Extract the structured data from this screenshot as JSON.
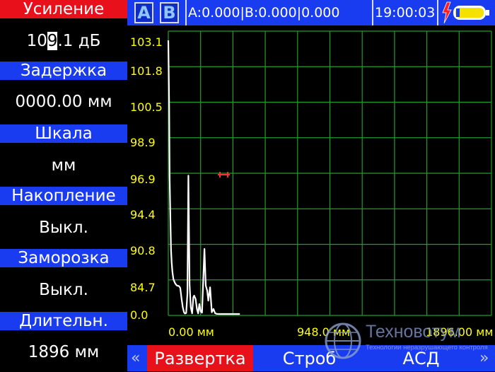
{
  "sidebar": {
    "gain_label": "Усиление",
    "gain_value_prefix": "10",
    "gain_value_cursor": "9",
    "gain_value_suffix": ".1 дБ",
    "delay_label": "Задержка",
    "delay_value": "0000.00 мм",
    "scale_label": "Шкала",
    "scale_value": "мм",
    "accumulation_label": "Накопление",
    "accumulation_value": "Выкл.",
    "freeze_label": "Заморозка",
    "freeze_value": "Выкл.",
    "duration_label": "Длительн.",
    "duration_value": "1896 мм"
  },
  "topbar": {
    "gate_a": "A",
    "gate_b": "B",
    "readout": "A:0.000|B:0.000|0.000",
    "clock": "19:00:03"
  },
  "colors": {
    "accent_blue": "#1a3cf0",
    "active_red": "#e8101a",
    "grid_green": "#1f9e2a",
    "tick_yellow": "#ffff00",
    "signal_white": "#ffffff",
    "gate_marker": "#ff3030"
  },
  "chart_data": {
    "type": "line",
    "y_tick_labels": [
      "103.1",
      "101.8",
      "100.5",
      "98.9",
      "96.9",
      "94.4",
      "90.8",
      "84.7",
      "0.0"
    ],
    "x_tick_labels": [
      "0.00 мм",
      "948.0 мм",
      "1896.00 мм"
    ],
    "x_range": [
      0,
      1896
    ],
    "grid": true,
    "gate_level_label": "96.9",
    "series": [
      {
        "x": [
          0,
          5,
          8,
          12,
          16,
          20,
          24,
          30,
          38,
          45,
          52,
          60,
          65,
          70,
          78,
          85,
          92,
          98,
          105,
          112,
          118,
          125,
          132,
          140,
          147,
          152,
          160,
          168,
          175,
          182,
          190,
          198,
          205,
          212,
          220,
          228,
          235,
          245,
          255,
          265,
          275,
          285,
          300,
          330,
          360,
          365,
          380,
          420
        ],
        "y": [
          103.1,
          100.5,
          96.9,
          94.0,
          90.5,
          88.5,
          87.0,
          85.8,
          85.2,
          84.9,
          84.7,
          84.2,
          82.0,
          78.0,
          45.0,
          20.0,
          5.0,
          1.5,
          3.0,
          60.0,
          97.0,
          84.9,
          20.0,
          2.0,
          50.0,
          55.0,
          45.0,
          15.0,
          2.0,
          30.0,
          8.0,
          4.0,
          85.6,
          90.8,
          84.6,
          70.0,
          40.0,
          80.0,
          5.0,
          15.0,
          2.0,
          0.5,
          0.0,
          0.0,
          0.0,
          0.0,
          0.0,
          0.0
        ]
      }
    ]
  },
  "bottombar": {
    "left_chev": "«",
    "key_sweep": "Развертка",
    "key_gate": "Строб",
    "key_asd": "АСД",
    "right_chev": "»"
  },
  "watermark": {
    "title": "Техновотум",
    "subtitle": "Технологии неразрушающего контроля"
  }
}
